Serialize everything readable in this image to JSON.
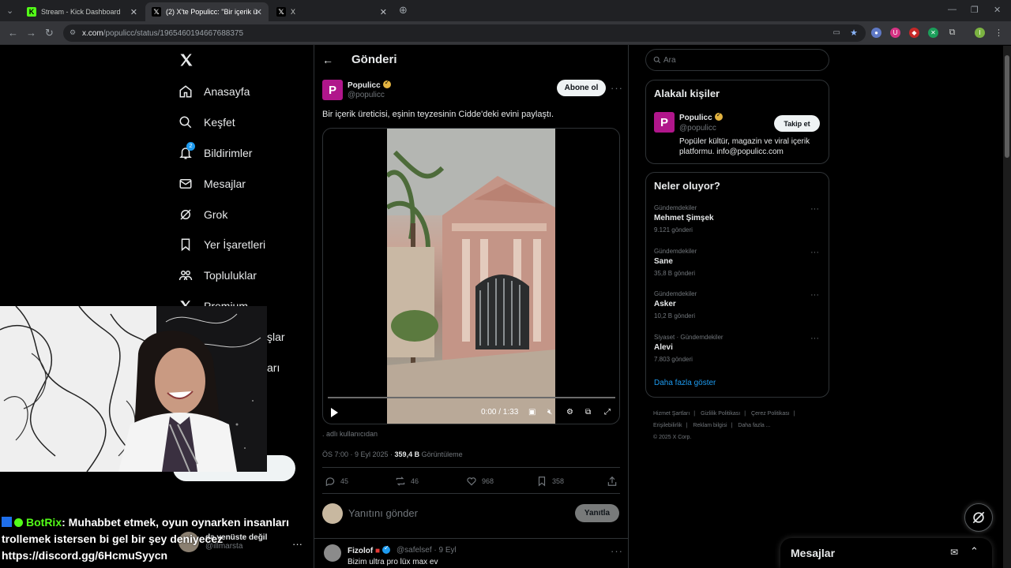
{
  "browser": {
    "tabs": [
      {
        "title": "Stream - Kick Dashboard",
        "icon": "kick-icon"
      },
      {
        "title": "(2) X'te Populicc: \"Bir içerik üreti",
        "icon": "x-logo-icon"
      },
      {
        "title": "X",
        "icon": "x-logo-icon"
      }
    ],
    "url_host": "x.com",
    "url_path": "/populicc/status/1965460194667688375"
  },
  "nav": {
    "items": [
      {
        "label": "Anasayfa",
        "icon": "home-icon"
      },
      {
        "label": "Keşfet",
        "icon": "search-icon"
      },
      {
        "label": "Bildirimler",
        "icon": "bell-icon",
        "badge": "2"
      },
      {
        "label": "Mesajlar",
        "icon": "mail-icon"
      },
      {
        "label": "Grok",
        "icon": "grok-icon"
      },
      {
        "label": "Yer İşaretleri",
        "icon": "bookmark-icon"
      },
      {
        "label": "Topluluklar",
        "icon": "communities-icon"
      },
      {
        "label": "Premium",
        "icon": "x-logo-icon"
      },
      {
        "label": "şlar",
        "icon": ""
      },
      {
        "label": "arı",
        "icon": ""
      }
    ],
    "account": {
      "name": "da venüste değil",
      "handle": "@illmarsta"
    }
  },
  "stream_chat": {
    "user": "BotRix",
    "message": ": Muhabbet etmek, oyun oynarken insanları trollemek istersen bi gel bir şey deniyecez",
    "link": "https://discord.gg/6HcmuSyycn"
  },
  "post": {
    "header_title": "Gönderi",
    "author_name": "Populicc",
    "author_handle": "@populicc",
    "subscribe_label": "Abone ol",
    "text": "Bir içerik üreticisi, eşinin teyzesinin Cidde'deki evini paylaştı.",
    "video_time": "0:00 / 1:33",
    "creator_note": ". adlı kullanıcıdan",
    "timestamp": "ÖS 7:00 · 9 Eyl 2025 · ",
    "views_count": "359,4 B",
    "views_label": " Görüntüleme",
    "actions": {
      "replies": "45",
      "reposts": "46",
      "likes": "968",
      "bookmarks": "358"
    },
    "reply_placeholder": "Yanıtını gönder",
    "reply_button": "Yanıtla"
  },
  "reply": {
    "name": "Fizolof",
    "handle": "@safelsef · 9 Eyl",
    "text": "Bizim ultra pro lüx max ev"
  },
  "sidebar": {
    "search_placeholder": "Ara",
    "related_title": "Alakalı kişiler",
    "related": {
      "name": "Populicc",
      "handle": "@populicc",
      "bio": "Popüler kültür, magazin ve viral içerik platformu. info@populicc.com",
      "follow_label": "Takip et"
    },
    "trends_title": "Neler oluyor?",
    "trends": [
      {
        "category": "Gündemdekiler",
        "name": "Mehmet Şimşek",
        "count": "9.121 gönderi"
      },
      {
        "category": "Gündemdekiler",
        "name": "Sane",
        "count": "35,8 B gönderi"
      },
      {
        "category": "Gündemdekiler",
        "name": "Asker",
        "count": "10,2 B gönderi"
      },
      {
        "category": "Siyaset · Gündemdekiler",
        "name": "Alevi",
        "count": "7.803 gönderi"
      }
    ],
    "show_more": "Daha fazla göster",
    "footer": [
      "Hizmet Şartları",
      "|",
      "Gizlilik Politikası",
      "|",
      "Çerez Politikası",
      "|",
      "Erişilebilirlik",
      "|",
      "Reklam bilgisi",
      "|",
      "Daha fazla ...",
      "© 2025 X Corp."
    ]
  },
  "messages_drawer": {
    "title": "Mesajlar"
  },
  "colors": {
    "accent": "#1d9bf0",
    "populicc": "#b0168b",
    "kick_green": "#53fc18",
    "verified_gold": "#e3b341"
  }
}
